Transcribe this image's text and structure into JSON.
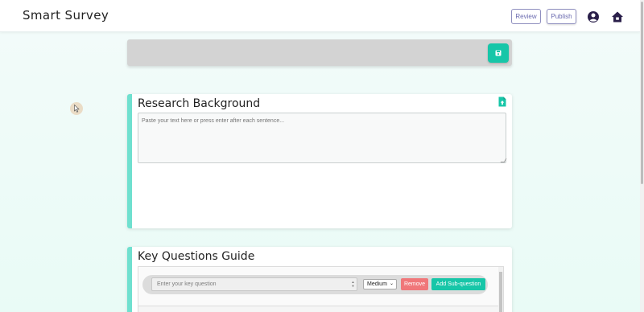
{
  "navbar": {
    "brand": "Smart Survey",
    "review_label": "Review",
    "publish_label": "Publish",
    "icons": [
      "user-circle-icon",
      "home-icon"
    ]
  },
  "toolbar": {
    "save_icon": "floppy-disk-icon",
    "accent": "#17c6a8"
  },
  "research": {
    "title": "Research Background",
    "placeholder": "Paste your text here or press enter after each sentence...",
    "upload_icon": "file-upload-icon"
  },
  "key_questions": {
    "title": "Key Questions Guide",
    "input_placeholder": "Enter your key question",
    "priority_value": "Medium",
    "remove_label": "Remove",
    "add_sub_label": "Add Sub-question"
  },
  "colors": {
    "accent": "#17c6a8",
    "card_border": "#6fe0cf",
    "remove": "#f0777a",
    "nav_button": "#6b6bb0"
  }
}
